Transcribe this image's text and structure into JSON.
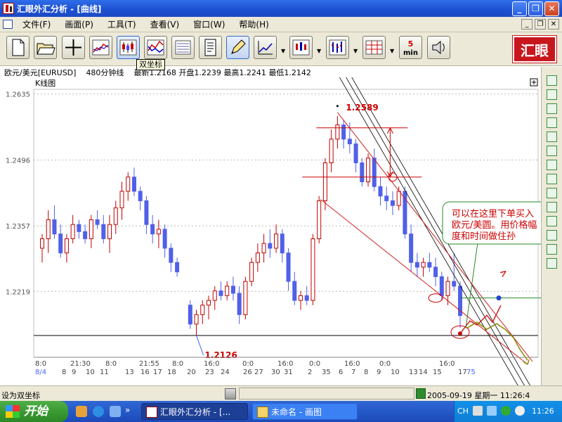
{
  "window": {
    "title": "汇眼外汇分析 - [曲线]"
  },
  "menu": {
    "items": [
      "文件(F)",
      "画面(P)",
      "工具(T)",
      "查看(V)",
      "窗口(W)",
      "帮助(H)"
    ]
  },
  "toolbar": {
    "tooltip": "双坐标",
    "brand_logo": "汇眼",
    "min_label_num": "5",
    "min_label_unit": "min",
    "buttons": [
      "new-document",
      "open-folder",
      "crosshair",
      "line-chart",
      "candlestick-chart",
      "dual-axis",
      "report",
      "notes",
      "pencil",
      "trend-tools",
      "candle-menu",
      "bar-menu",
      "grid-menu",
      "minute-period",
      "sound"
    ]
  },
  "infobar": {
    "symbol": "欧元/美元[EURUSD]",
    "period": "480分钟线",
    "latest": "最新1.2168",
    "open": "开盘1.2239",
    "high": "最高1.2241",
    "low": "最低1.2142"
  },
  "chart_data": {
    "type": "candlestick",
    "pane_title": "K线图",
    "y_ticks": [
      "1.2635",
      "1.2496",
      "1.2357",
      "1.2219"
    ],
    "ylim": [
      1.208,
      1.2645
    ],
    "x_ticks": [
      "8:0",
      "21:30",
      "8:0",
      "21:55",
      "8:0",
      "16:0",
      "0:0",
      "16:0",
      "0:0",
      "16:0",
      "0:0",
      "16:0"
    ],
    "x_dates": [
      "8/4",
      "8",
      "9",
      "10",
      "11",
      "13",
      "16",
      "17",
      "18",
      "20",
      "23",
      "24",
      "26",
      "27",
      "30",
      "31",
      "2",
      "35",
      "6",
      "7",
      "8",
      "9",
      "10",
      "13",
      "14",
      "15",
      "17",
      "75"
    ],
    "annotations": {
      "high_label": "1.2589",
      "low_label": "1.2126",
      "callout": [
        "可以在这里下单买入",
        "欧元/美圆。用价格幅",
        "度和时间做住孙"
      ]
    },
    "candles": [
      {
        "o": 1.231,
        "h": 1.234,
        "l": 1.228,
        "c": 1.233
      },
      {
        "o": 1.233,
        "h": 1.239,
        "l": 1.23,
        "c": 1.237
      },
      {
        "o": 1.237,
        "h": 1.24,
        "l": 1.233,
        "c": 1.234
      },
      {
        "o": 1.234,
        "h": 1.236,
        "l": 1.229,
        "c": 1.23
      },
      {
        "o": 1.23,
        "h": 1.234,
        "l": 1.228,
        "c": 1.233
      },
      {
        "o": 1.233,
        "h": 1.238,
        "l": 1.232,
        "c": 1.236
      },
      {
        "o": 1.236,
        "h": 1.237,
        "l": 1.233,
        "c": 1.2345
      },
      {
        "o": 1.2345,
        "h": 1.236,
        "l": 1.232,
        "c": 1.233
      },
      {
        "o": 1.233,
        "h": 1.238,
        "l": 1.231,
        "c": 1.237
      },
      {
        "o": 1.237,
        "h": 1.239,
        "l": 1.235,
        "c": 1.236
      },
      {
        "o": 1.236,
        "h": 1.238,
        "l": 1.232,
        "c": 1.233
      },
      {
        "o": 1.233,
        "h": 1.238,
        "l": 1.23,
        "c": 1.236
      },
      {
        "o": 1.236,
        "h": 1.241,
        "l": 1.234,
        "c": 1.2395
      },
      {
        "o": 1.2395,
        "h": 1.245,
        "l": 1.237,
        "c": 1.243
      },
      {
        "o": 1.243,
        "h": 1.247,
        "l": 1.241,
        "c": 1.246
      },
      {
        "o": 1.246,
        "h": 1.248,
        "l": 1.242,
        "c": 1.243
      },
      {
        "o": 1.243,
        "h": 1.244,
        "l": 1.239,
        "c": 1.241
      },
      {
        "o": 1.241,
        "h": 1.242,
        "l": 1.234,
        "c": 1.236
      },
      {
        "o": 1.236,
        "h": 1.238,
        "l": 1.232,
        "c": 1.234
      },
      {
        "o": 1.234,
        "h": 1.237,
        "l": 1.231,
        "c": 1.235
      },
      {
        "o": 1.235,
        "h": 1.236,
        "l": 1.229,
        "c": 1.231
      },
      {
        "o": 1.231,
        "h": 1.232,
        "l": 1.226,
        "c": 1.228
      },
      {
        "o": 1.228,
        "h": 1.229,
        "l": 1.225,
        "c": 1.226
      },
      {
        "o": 1.219,
        "h": 1.22,
        "l": 1.214,
        "c": 1.215
      },
      {
        "o": 1.215,
        "h": 1.218,
        "l": 1.2126,
        "c": 1.217
      },
      {
        "o": 1.217,
        "h": 1.22,
        "l": 1.215,
        "c": 1.219
      },
      {
        "o": 1.219,
        "h": 1.221,
        "l": 1.216,
        "c": 1.22
      },
      {
        "o": 1.22,
        "h": 1.223,
        "l": 1.218,
        "c": 1.222
      },
      {
        "o": 1.222,
        "h": 1.224,
        "l": 1.22,
        "c": 1.221
      },
      {
        "o": 1.221,
        "h": 1.224,
        "l": 1.22,
        "c": 1.223
      },
      {
        "o": 1.223,
        "h": 1.225,
        "l": 1.22,
        "c": 1.2215
      },
      {
        "o": 1.2215,
        "h": 1.223,
        "l": 1.215,
        "c": 1.217
      },
      {
        "o": 1.217,
        "h": 1.225,
        "l": 1.216,
        "c": 1.224
      },
      {
        "o": 1.224,
        "h": 1.229,
        "l": 1.223,
        "c": 1.228
      },
      {
        "o": 1.228,
        "h": 1.232,
        "l": 1.226,
        "c": 1.23
      },
      {
        "o": 1.23,
        "h": 1.234,
        "l": 1.228,
        "c": 1.232
      },
      {
        "o": 1.232,
        "h": 1.235,
        "l": 1.229,
        "c": 1.231
      },
      {
        "o": 1.231,
        "h": 1.236,
        "l": 1.23,
        "c": 1.234
      },
      {
        "o": 1.234,
        "h": 1.235,
        "l": 1.228,
        "c": 1.23
      },
      {
        "o": 1.23,
        "h": 1.231,
        "l": 1.222,
        "c": 1.224
      },
      {
        "o": 1.224,
        "h": 1.226,
        "l": 1.219,
        "c": 1.22
      },
      {
        "o": 1.22,
        "h": 1.222,
        "l": 1.218,
        "c": 1.221
      },
      {
        "o": 1.221,
        "h": 1.223,
        "l": 1.219,
        "c": 1.22
      },
      {
        "o": 1.22,
        "h": 1.234,
        "l": 1.219,
        "c": 1.233
      },
      {
        "o": 1.233,
        "h": 1.242,
        "l": 1.232,
        "c": 1.241
      },
      {
        "o": 1.241,
        "h": 1.25,
        "l": 1.239,
        "c": 1.249
      },
      {
        "o": 1.249,
        "h": 1.256,
        "l": 1.247,
        "c": 1.254
      },
      {
        "o": 1.254,
        "h": 1.2589,
        "l": 1.252,
        "c": 1.257
      },
      {
        "o": 1.257,
        "h": 1.258,
        "l": 1.252,
        "c": 1.254
      },
      {
        "o": 1.254,
        "h": 1.2575,
        "l": 1.251,
        "c": 1.253
      },
      {
        "o": 1.253,
        "h": 1.254,
        "l": 1.247,
        "c": 1.249
      },
      {
        "o": 1.249,
        "h": 1.25,
        "l": 1.244,
        "c": 1.245
      },
      {
        "o": 1.245,
        "h": 1.251,
        "l": 1.244,
        "c": 1.25
      },
      {
        "o": 1.25,
        "h": 1.252,
        "l": 1.243,
        "c": 1.244
      },
      {
        "o": 1.244,
        "h": 1.246,
        "l": 1.24,
        "c": 1.242
      },
      {
        "o": 1.242,
        "h": 1.244,
        "l": 1.239,
        "c": 1.241
      },
      {
        "o": 1.241,
        "h": 1.243,
        "l": 1.238,
        "c": 1.24
      },
      {
        "o": 1.24,
        "h": 1.244,
        "l": 1.239,
        "c": 1.243
      },
      {
        "o": 1.243,
        "h": 1.244,
        "l": 1.233,
        "c": 1.234
      },
      {
        "o": 1.234,
        "h": 1.236,
        "l": 1.226,
        "c": 1.228
      },
      {
        "o": 1.228,
        "h": 1.23,
        "l": 1.225,
        "c": 1.227
      },
      {
        "o": 1.227,
        "h": 1.229,
        "l": 1.225,
        "c": 1.228
      },
      {
        "o": 1.228,
        "h": 1.23,
        "l": 1.226,
        "c": 1.227
      },
      {
        "o": 1.227,
        "h": 1.229,
        "l": 1.223,
        "c": 1.225
      },
      {
        "o": 1.225,
        "h": 1.226,
        "l": 1.22,
        "c": 1.221
      },
      {
        "o": 1.221,
        "h": 1.225,
        "l": 1.219,
        "c": 1.224
      },
      {
        "o": 1.224,
        "h": 1.23,
        "l": 1.222,
        "c": 1.223
      },
      {
        "o": 1.223,
        "h": 1.224,
        "l": 1.2142,
        "c": 1.2168
      }
    ]
  },
  "status": {
    "left": "设为双坐标",
    "datetime": "2005-09-19 星期一 11:26:4"
  },
  "taskbar": {
    "start": "开始",
    "tasks": [
      "汇眼外汇分析 - [...",
      "未命名 - 画图"
    ],
    "tray_lang": "CH",
    "clock": "11:26"
  }
}
